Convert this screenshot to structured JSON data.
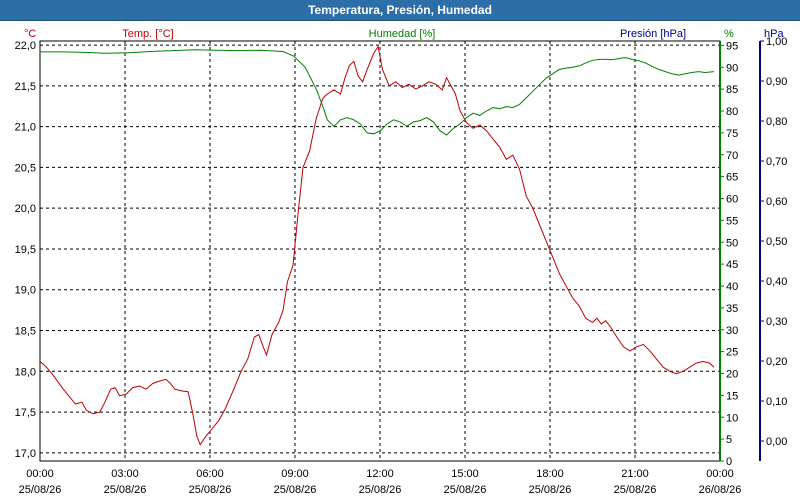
{
  "window": {
    "title": "Temperatura, Presión, Humedad"
  },
  "colors": {
    "temperature": "#c00000",
    "humidity": "#008000",
    "pressure": "#000080",
    "grid": "#000000",
    "axis_text": "#000000"
  },
  "chart_data": {
    "type": "line",
    "title": "Temperatura, Presión, Humedad",
    "grid": true,
    "x_ticks": [
      {
        "time": "00:00",
        "date": "25/08/26"
      },
      {
        "time": "03:00",
        "date": "25/08/26"
      },
      {
        "time": "06:00",
        "date": "25/08/26"
      },
      {
        "time": "09:00",
        "date": "25/08/26"
      },
      {
        "time": "12:00",
        "date": "25/08/26"
      },
      {
        "time": "15:00",
        "date": "25/08/26"
      },
      {
        "time": "18:00",
        "date": "25/08/26"
      },
      {
        "time": "21:00",
        "date": "25/08/26"
      },
      {
        "time": "00:00",
        "date": "26/08/26"
      }
    ],
    "x_range_hours": [
      0,
      24
    ],
    "axes": {
      "temperature": {
        "unit": "°C",
        "legend": "Temp. [°C]",
        "ylim": [
          16.9,
          22.05
        ],
        "ticks": [
          "17,0",
          "17,5",
          "18,0",
          "18,5",
          "19,0",
          "19,5",
          "20,0",
          "20,5",
          "21,0",
          "21,5",
          "22,0"
        ],
        "tick_values": [
          17.0,
          17.5,
          18.0,
          18.5,
          19.0,
          19.5,
          20.0,
          20.5,
          21.0,
          21.5,
          22.0
        ]
      },
      "humidity": {
        "unit": "%",
        "legend": "Humedad [%]",
        "ylim": [
          0,
          96
        ],
        "ticks": [
          "0",
          "5",
          "10",
          "15",
          "20",
          "25",
          "30",
          "35",
          "40",
          "45",
          "50",
          "55",
          "60",
          "65",
          "70",
          "75",
          "80",
          "85",
          "90",
          "95"
        ],
        "tick_values": [
          0,
          5,
          10,
          15,
          20,
          25,
          30,
          35,
          40,
          45,
          50,
          55,
          60,
          65,
          70,
          75,
          80,
          85,
          90,
          95
        ]
      },
      "pressure": {
        "unit": "hPa",
        "legend": "Presión [hPa]",
        "ylim": [
          -0.05,
          1.0
        ],
        "ticks": [
          "0,00",
          "0,10",
          "0,20",
          "0,30",
          "0,40",
          "0,50",
          "0,60",
          "0,70",
          "0,80",
          "0,90",
          "1,00"
        ],
        "tick_values": [
          0.0,
          0.1,
          0.2,
          0.3,
          0.4,
          0.5,
          0.6,
          0.7,
          0.8,
          0.9,
          1.0
        ]
      }
    },
    "series": [
      {
        "name": "Temp. [°C]",
        "axis": "temperature",
        "points": [
          [
            0,
            18.12
          ],
          [
            0.3,
            18.05
          ],
          [
            0.6,
            17.95
          ],
          [
            1.0,
            17.8
          ],
          [
            1.3,
            17.7
          ],
          [
            1.6,
            17.6
          ],
          [
            1.9,
            17.62
          ],
          [
            2.1,
            17.52
          ],
          [
            2.4,
            17.48
          ],
          [
            2.7,
            17.5
          ],
          [
            2.9,
            17.6
          ],
          [
            3.2,
            17.78
          ],
          [
            3.4,
            17.8
          ],
          [
            3.6,
            17.7
          ],
          [
            3.9,
            17.72
          ],
          [
            4.2,
            17.8
          ],
          [
            4.5,
            17.82
          ],
          [
            4.8,
            17.78
          ],
          [
            5.1,
            17.85
          ],
          [
            5.4,
            17.88
          ],
          [
            5.7,
            17.9
          ],
          [
            5.9,
            17.85
          ],
          [
            6.1,
            17.78
          ],
          [
            6.4,
            17.76
          ],
          [
            6.7,
            17.75
          ],
          [
            6.9,
            17.5
          ],
          [
            7.1,
            17.2
          ],
          [
            7.25,
            17.1
          ],
          [
            7.5,
            17.2
          ],
          [
            7.8,
            17.3
          ],
          [
            8.1,
            17.4
          ],
          [
            8.4,
            17.55
          ],
          [
            8.8,
            17.8
          ],
          [
            9.1,
            18.0
          ],
          [
            9.4,
            18.15
          ],
          [
            9.7,
            18.42
          ],
          [
            9.9,
            18.45
          ],
          [
            10.1,
            18.3
          ],
          [
            10.25,
            18.2
          ],
          [
            10.5,
            18.45
          ],
          [
            10.8,
            18.6
          ],
          [
            11.0,
            18.75
          ],
          [
            11.2,
            19.1
          ],
          [
            11.45,
            19.3
          ],
          [
            11.7,
            20.0
          ],
          [
            11.9,
            20.5
          ],
          [
            12.2,
            20.7
          ],
          [
            12.5,
            21.1
          ],
          [
            12.8,
            21.35
          ],
          [
            13.0,
            21.4
          ],
          [
            13.3,
            21.45
          ],
          [
            13.6,
            21.4
          ],
          [
            13.8,
            21.6
          ],
          [
            14.0,
            21.75
          ],
          [
            14.2,
            21.8
          ],
          [
            14.4,
            21.62
          ],
          [
            14.6,
            21.55
          ],
          [
            14.8,
            21.7
          ],
          [
            15.1,
            21.9
          ],
          [
            15.3,
            21.98
          ],
          [
            15.5,
            21.7
          ],
          [
            15.8,
            21.5
          ],
          [
            16.1,
            21.55
          ],
          [
            16.4,
            21.48
          ],
          [
            16.7,
            21.52
          ],
          [
            17.0,
            21.46
          ],
          [
            17.3,
            21.5
          ],
          [
            17.6,
            21.55
          ],
          [
            17.9,
            21.52
          ],
          [
            18.2,
            21.45
          ],
          [
            18.4,
            21.6
          ],
          [
            18.6,
            21.5
          ],
          [
            18.8,
            21.4
          ],
          [
            19.0,
            21.2
          ],
          [
            19.3,
            21.05
          ],
          [
            19.6,
            20.98
          ],
          [
            19.9,
            21.02
          ],
          [
            20.2,
            20.95
          ],
          [
            20.5,
            20.85
          ],
          [
            20.8,
            20.75
          ],
          [
            21.1,
            20.6
          ],
          [
            21.4,
            20.65
          ],
          [
            21.7,
            20.48
          ],
          [
            22.0,
            20.15
          ],
          [
            22.3,
            20.0
          ],
          [
            22.6,
            19.8
          ],
          [
            22.9,
            19.6
          ],
          [
            23.2,
            19.4
          ],
          [
            23.5,
            19.2
          ],
          [
            23.8,
            19.05
          ],
          [
            24.1,
            18.9
          ],
          [
            24.4,
            18.8
          ],
          [
            24.7,
            18.65
          ],
          [
            25.0,
            18.6
          ],
          [
            25.2,
            18.65
          ],
          [
            25.4,
            18.58
          ],
          [
            25.6,
            18.62
          ],
          [
            25.8,
            18.55
          ],
          [
            26.1,
            18.42
          ],
          [
            26.4,
            18.3
          ],
          [
            26.7,
            18.25
          ],
          [
            27.0,
            18.3
          ],
          [
            27.3,
            18.33
          ],
          [
            27.6,
            18.25
          ],
          [
            27.9,
            18.15
          ],
          [
            28.2,
            18.05
          ],
          [
            28.5,
            18.0
          ],
          [
            28.8,
            17.97
          ],
          [
            29.1,
            18.0
          ],
          [
            29.4,
            18.05
          ],
          [
            29.7,
            18.1
          ],
          [
            30.0,
            18.12
          ],
          [
            30.3,
            18.1
          ],
          [
            30.5,
            18.05
          ]
        ]
      },
      {
        "name": "Humedad [%]",
        "axis": "humidity",
        "points": [
          [
            0,
            93.5
          ],
          [
            1.0,
            93.5
          ],
          [
            2.0,
            93.4
          ],
          [
            3.0,
            93.2
          ],
          [
            4.0,
            93.3
          ],
          [
            5.0,
            93.6
          ],
          [
            6.0,
            93.8
          ],
          [
            7.0,
            94.0
          ],
          [
            8.0,
            93.9
          ],
          [
            9.0,
            93.8
          ],
          [
            10.0,
            93.9
          ],
          [
            11.0,
            93.6
          ],
          [
            11.5,
            92.5
          ],
          [
            12.0,
            90.0
          ],
          [
            12.5,
            85.0
          ],
          [
            12.8,
            81.0
          ],
          [
            13.0,
            78.0
          ],
          [
            13.3,
            76.5
          ],
          [
            13.6,
            78.0
          ],
          [
            13.9,
            78.5
          ],
          [
            14.2,
            78.0
          ],
          [
            14.5,
            77.0
          ],
          [
            14.8,
            75.0
          ],
          [
            15.1,
            74.8
          ],
          [
            15.4,
            75.5
          ],
          [
            15.7,
            77.0
          ],
          [
            16.0,
            78.0
          ],
          [
            16.3,
            77.5
          ],
          [
            16.6,
            76.5
          ],
          [
            16.9,
            77.5
          ],
          [
            17.2,
            77.8
          ],
          [
            17.5,
            78.5
          ],
          [
            17.8,
            77.5
          ],
          [
            18.1,
            75.5
          ],
          [
            18.4,
            74.5
          ],
          [
            18.7,
            76.0
          ],
          [
            19.0,
            77.0
          ],
          [
            19.3,
            78.5
          ],
          [
            19.6,
            79.5
          ],
          [
            19.9,
            79.0
          ],
          [
            20.2,
            80.0
          ],
          [
            20.5,
            80.8
          ],
          [
            20.8,
            80.5
          ],
          [
            21.1,
            81.0
          ],
          [
            21.4,
            80.8
          ],
          [
            21.7,
            81.5
          ],
          [
            22.0,
            83.0
          ],
          [
            22.3,
            84.5
          ],
          [
            22.6,
            86.0
          ],
          [
            22.9,
            87.5
          ],
          [
            23.2,
            88.5
          ],
          [
            23.5,
            89.5
          ],
          [
            23.8,
            89.8
          ],
          [
            24.1,
            90.0
          ],
          [
            24.4,
            90.3
          ],
          [
            24.7,
            91.0
          ],
          [
            25.0,
            91.6
          ],
          [
            25.3,
            91.8
          ],
          [
            25.6,
            91.8
          ],
          [
            25.9,
            91.7
          ],
          [
            26.2,
            92.0
          ],
          [
            26.5,
            92.2
          ],
          [
            26.8,
            91.8
          ],
          [
            27.1,
            91.5
          ],
          [
            27.4,
            91.0
          ],
          [
            27.7,
            90.2
          ],
          [
            28.0,
            89.5
          ],
          [
            28.3,
            89.0
          ],
          [
            28.6,
            88.5
          ],
          [
            28.9,
            88.2
          ],
          [
            29.2,
            88.5
          ],
          [
            29.5,
            88.8
          ],
          [
            29.8,
            89.0
          ],
          [
            30.1,
            88.8
          ],
          [
            30.5,
            89.0
          ]
        ]
      }
    ]
  }
}
